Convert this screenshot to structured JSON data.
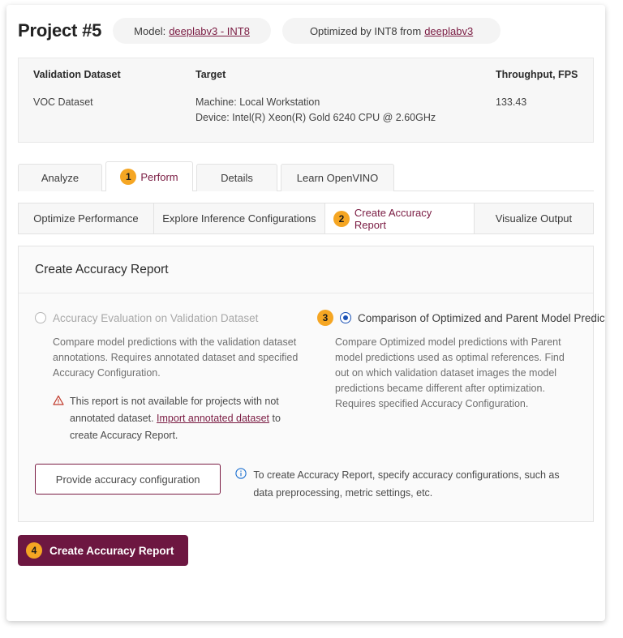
{
  "header": {
    "project_title": "Project #5",
    "model_chip": {
      "prefix": "Model:",
      "link": "deeplabv3 - INT8"
    },
    "optimized_chip": {
      "prefix": "Optimized by INT8 from",
      "link": "deeplabv3"
    }
  },
  "info_panel": {
    "columns": [
      "Validation Dataset",
      "Target",
      "Throughput, FPS"
    ],
    "dataset": "VOC Dataset",
    "target_machine": "Machine: Local Workstation",
    "target_device": "Device: Intel(R) Xeon(R) Gold 6240 CPU @ 2.60GHz",
    "throughput": "133.43"
  },
  "tabs": [
    {
      "label": "Analyze",
      "badge": null,
      "active": false
    },
    {
      "label": "Perform",
      "badge": "1",
      "active": true
    },
    {
      "label": "Details",
      "badge": null,
      "active": false
    },
    {
      "label": "Learn OpenVINO",
      "badge": null,
      "active": false
    }
  ],
  "subtabs": [
    {
      "label": "Optimize Performance",
      "badge": null,
      "active": false
    },
    {
      "label": "Explore Inference Configurations",
      "badge": null,
      "active": false
    },
    {
      "label": "Create Accuracy Report",
      "badge": "2",
      "active": true
    },
    {
      "label": "Visualize Output",
      "badge": null,
      "active": false
    }
  ],
  "report": {
    "title": "Create Accuracy Report",
    "option_left": {
      "label": "Accuracy Evaluation on Validation Dataset",
      "selected": false,
      "disabled": true,
      "description": "Compare model predictions with the validation dataset annotations. Requires annotated dataset and specified Accuracy Configuration.",
      "warning_icon": "warning-triangle-icon",
      "warning_part1": "This report is not available for projects with not annotated dataset. ",
      "warning_link": "Import annotated dataset",
      "warning_part2": " to create Accuracy Report."
    },
    "option_right": {
      "badge": "3",
      "label": "Comparison of Optimized and Parent Model Predictions",
      "selected": true,
      "description": "Compare Optimized model predictions with Parent model predictions used as optimal references. Find out on which validation dataset images the model predictions became different after optimization. Requires specified Accuracy Configuration."
    },
    "config_button": "Provide accuracy configuration",
    "note_icon": "info-circle-icon",
    "note_text": "To create Accuracy Report, specify accuracy configurations, such as data preprocessing, metric settings, etc."
  },
  "primary_button": {
    "badge": "4",
    "label": "Create Accuracy Report"
  },
  "colors": {
    "brand_maroon": "#6d1741",
    "link_maroon": "#7a1b42",
    "badge_orange": "#f5a623",
    "radio_blue": "#1b52b5",
    "warning_red": "#c0392b",
    "info_blue": "#1b6fd0"
  }
}
